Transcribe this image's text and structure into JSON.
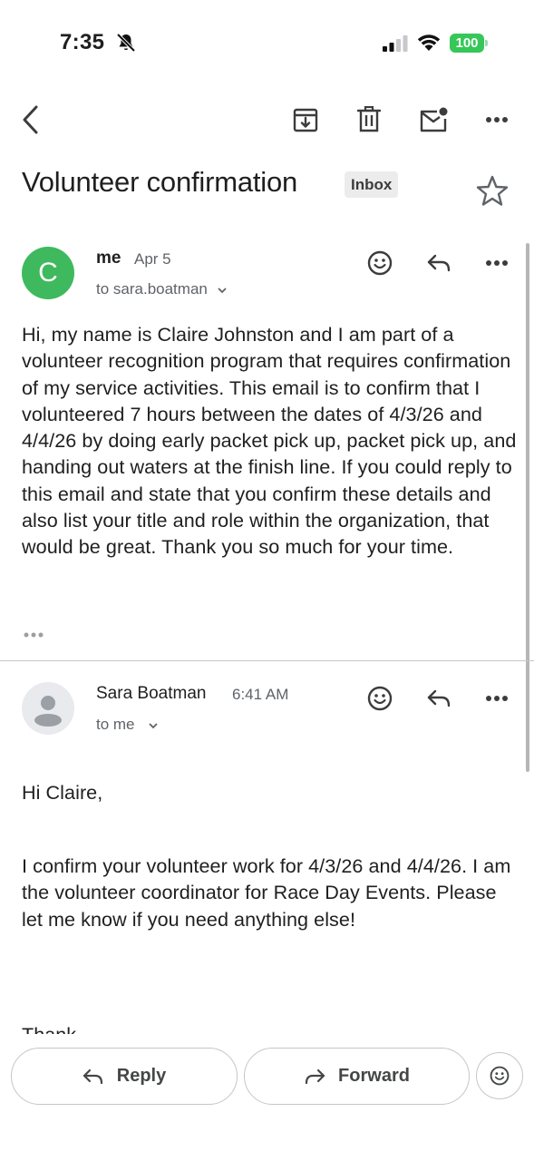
{
  "status_bar": {
    "time": "7:35",
    "battery": "100"
  },
  "toolbar": {
    "back_icon": "back-arrow-icon",
    "archive_icon": "archive-icon",
    "delete_icon": "trash-icon",
    "unread_icon": "mark-unread-icon",
    "more_icon": "more-horizontal-icon"
  },
  "subject": {
    "title": "Volunteer confirmation",
    "label": "Inbox"
  },
  "messages": [
    {
      "avatar_letter": "C",
      "avatar_color": "#3fb95d",
      "sender": "me",
      "date": "Apr 5",
      "recipient": "to sara.boatman",
      "body": "Hi, my name is Claire Johnston and I am part of a volunteer recognition program that requires confirmation of my service activities. This email is to confirm that I volunteered 7 hours between the dates of 4/3/26 and 4/4/26 by doing early packet pick up, packet pick up, and handing out waters at the finish line. If you could reply to this email and state that you confirm these details and also list your title and role within the organization, that would be great.  Thank you so much for your time."
    },
    {
      "sender": "Sara Boatman",
      "date": "6:41 AM",
      "recipient": "to me",
      "greeting": "Hi Claire,",
      "body": "I confirm your volunteer work for 4/3/26 and 4/4/26. I am the volunteer coordinator for Race Day Events. Please let me know if you need anything else!",
      "partial": "Thank"
    }
  ],
  "actions": {
    "reply": "Reply",
    "forward": "Forward"
  }
}
